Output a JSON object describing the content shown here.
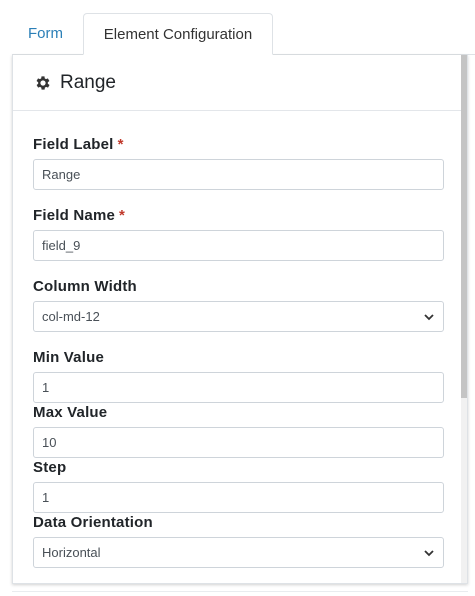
{
  "tabs": [
    {
      "label": "Form"
    },
    {
      "label": "Element Configuration"
    }
  ],
  "panel": {
    "title": "Range",
    "icon": "gear-icon"
  },
  "fields": {
    "field_label": {
      "label": "Field Label",
      "required_mark": "*",
      "value": "Range"
    },
    "field_name": {
      "label": "Field Name",
      "required_mark": "*",
      "value": "field_9"
    },
    "column_width": {
      "label": "Column Width",
      "value": "col-md-12"
    },
    "min_value": {
      "label": "Min Value",
      "value": "1"
    },
    "max_value": {
      "label": "Max Value",
      "value": "10"
    },
    "step": {
      "label": "Step",
      "value": "1"
    },
    "data_orientation": {
      "label": "Data Orientation",
      "value": "Horizontal"
    }
  },
  "colors": {
    "link": "#2b7fb7",
    "required": "#c0392b",
    "border": "#ced4da"
  }
}
